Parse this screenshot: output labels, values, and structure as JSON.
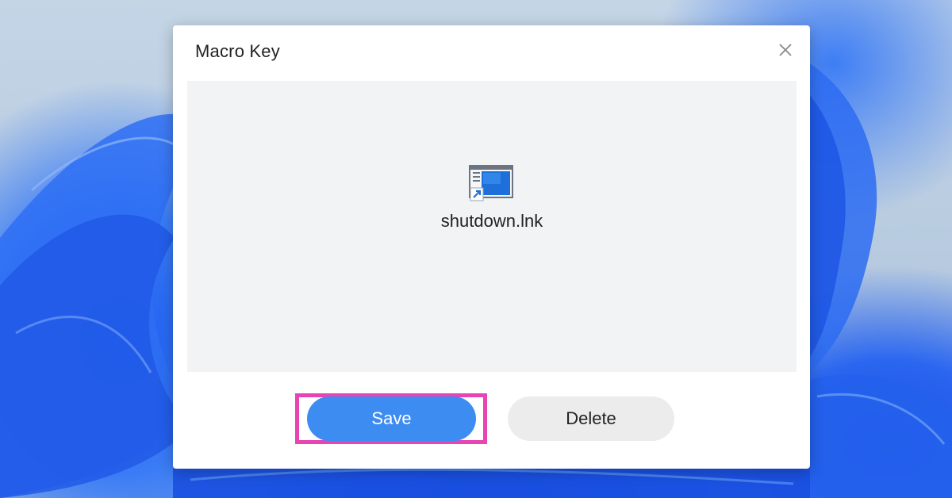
{
  "dialog": {
    "title": "Macro Key",
    "file_name": "shutdown.lnk",
    "save_label": "Save",
    "delete_label": "Delete"
  },
  "icons": {
    "close": "close-icon",
    "file": "shortcut-file-icon"
  },
  "colors": {
    "save_button": "#3d8cf2",
    "delete_button": "#ececec",
    "highlight": "#e845b4",
    "content_bg": "#f2f3f5"
  }
}
